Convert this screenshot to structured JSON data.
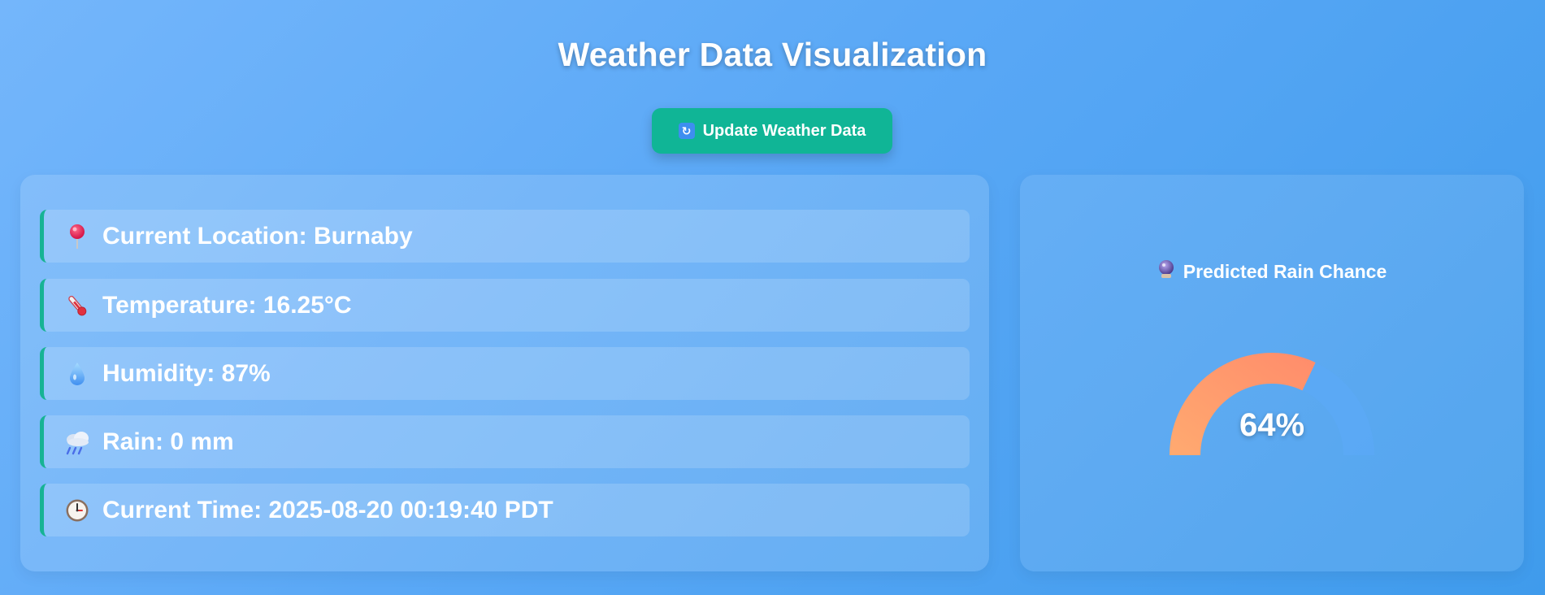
{
  "page": {
    "title": "Weather Data Visualization"
  },
  "toolbar": {
    "update_label": "Update Weather Data",
    "update_icon": "refresh-icon"
  },
  "info": {
    "location": {
      "icon": "pin-icon",
      "text": "Current Location: Burnaby"
    },
    "temperature": {
      "icon": "thermometer-icon",
      "text": "Temperature: 16.25°C"
    },
    "humidity": {
      "icon": "droplet-icon",
      "text": "Humidity: 87%"
    },
    "rain": {
      "icon": "rain-cloud-icon",
      "text": "Rain: 0 mm"
    },
    "time": {
      "icon": "clock-icon",
      "text": "Current Time: 2025-08-20 00:19:40 PDT"
    }
  },
  "gauge": {
    "title": "Predicted Rain Chance",
    "icon": "crystal-ball-icon",
    "value": 64,
    "display": "64%"
  },
  "colors": {
    "accent": "#10b596",
    "gauge_start": "#ffaa70",
    "gauge_end": "#ff8c6b",
    "gauge_track": "#5ba9f5"
  }
}
